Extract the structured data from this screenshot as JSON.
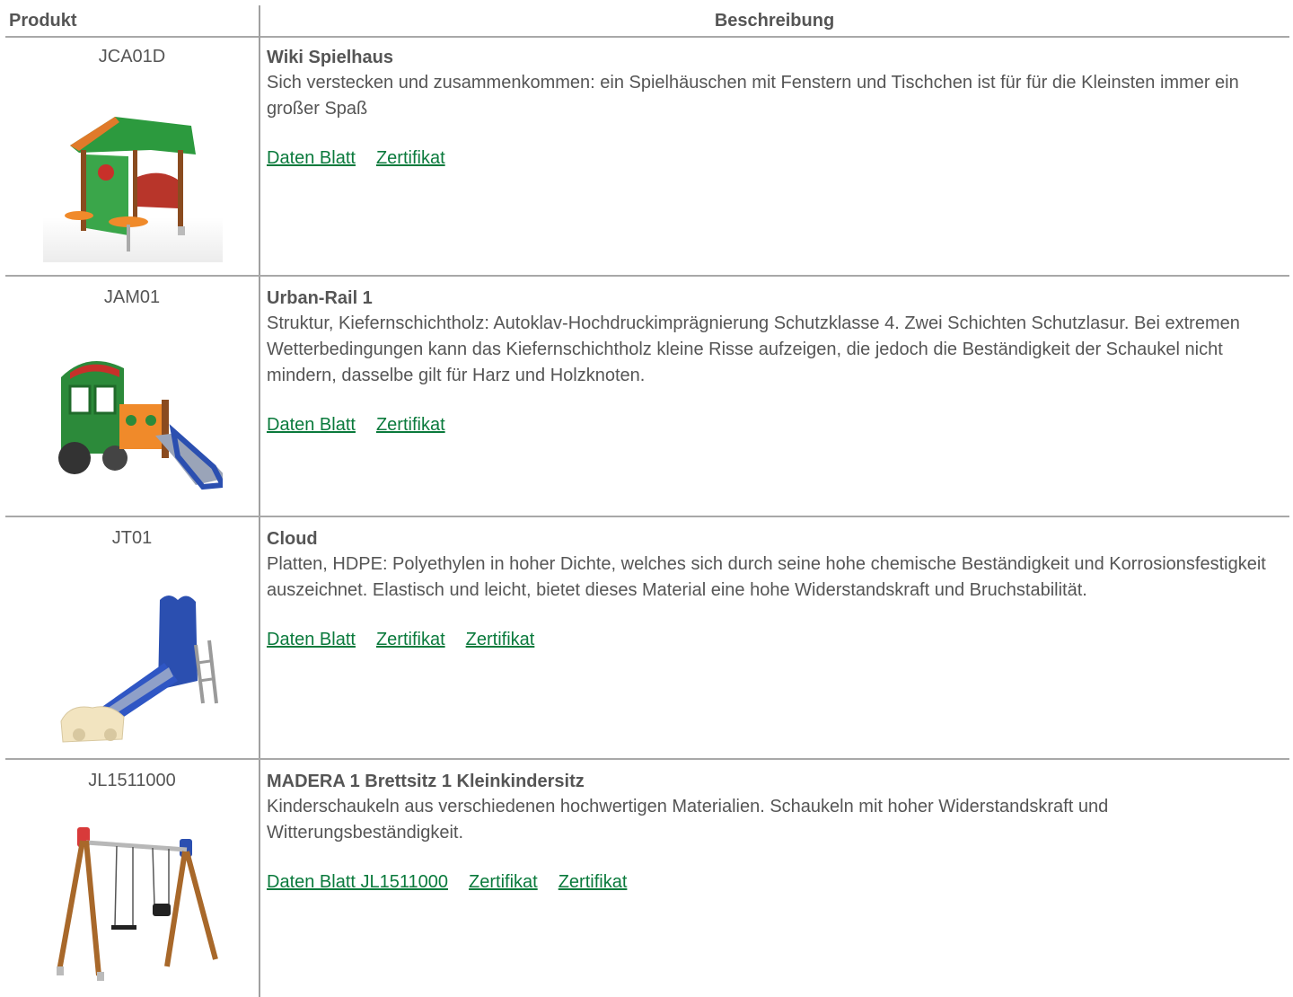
{
  "header": {
    "product_label": "Produkt",
    "description_label": "Beschreibung"
  },
  "rows": [
    {
      "code": "JCA01D",
      "title": "Wiki Spielhaus",
      "text": "Sich verstecken und zusammenkommen: ein Spielhäuschen mit Fenstern und Tischchen ist für für die Kleinsten immer ein großer Spaß",
      "links": [
        "Daten Blatt",
        "Zertifikat"
      ]
    },
    {
      "code": "JAM01",
      "title": "Urban-Rail 1",
      "text": "Struktur, Kiefernschichtholz: Autoklav-Hochdruckimprägnierung Schutzklasse 4. Zwei Schichten Schutzlasur. Bei extremen Wetterbedingungen kann das Kiefernschichtholz kleine Risse aufzeigen, die jedoch die Beständigkeit der Schaukel nicht mindern, dasselbe gilt für Harz und Holzknoten.",
      "links": [
        "Daten Blatt",
        "Zertifikat"
      ]
    },
    {
      "code": "JT01",
      "title": "Cloud",
      "text": "Platten, HDPE: Polyethylen in hoher Dichte, welches sich durch seine hohe chemische Beständigkeit und Korrosionsfestigkeit auszeichnet. Elastisch und leicht, bietet dieses Material eine hohe Widerstandskraft und Bruchstabilität.",
      "links": [
        "Daten Blatt",
        "Zertifikat",
        "Zertifikat"
      ]
    },
    {
      "code": "JL1511000",
      "title": "MADERA 1 Brettsitz 1 Kleinkindersitz",
      "text": "Kinderschaukeln aus verschiedenen hochwertigen Materialien. Schaukeln mit hoher Widerstandskraft und Witterungsbeständigkeit.",
      "links": [
        "Daten Blatt JL1511000",
        "Zertifikat",
        "Zertifikat"
      ]
    }
  ],
  "colors": {
    "text": "#555555",
    "link": "#0a7a3c",
    "rule": "#a8a8a8"
  }
}
